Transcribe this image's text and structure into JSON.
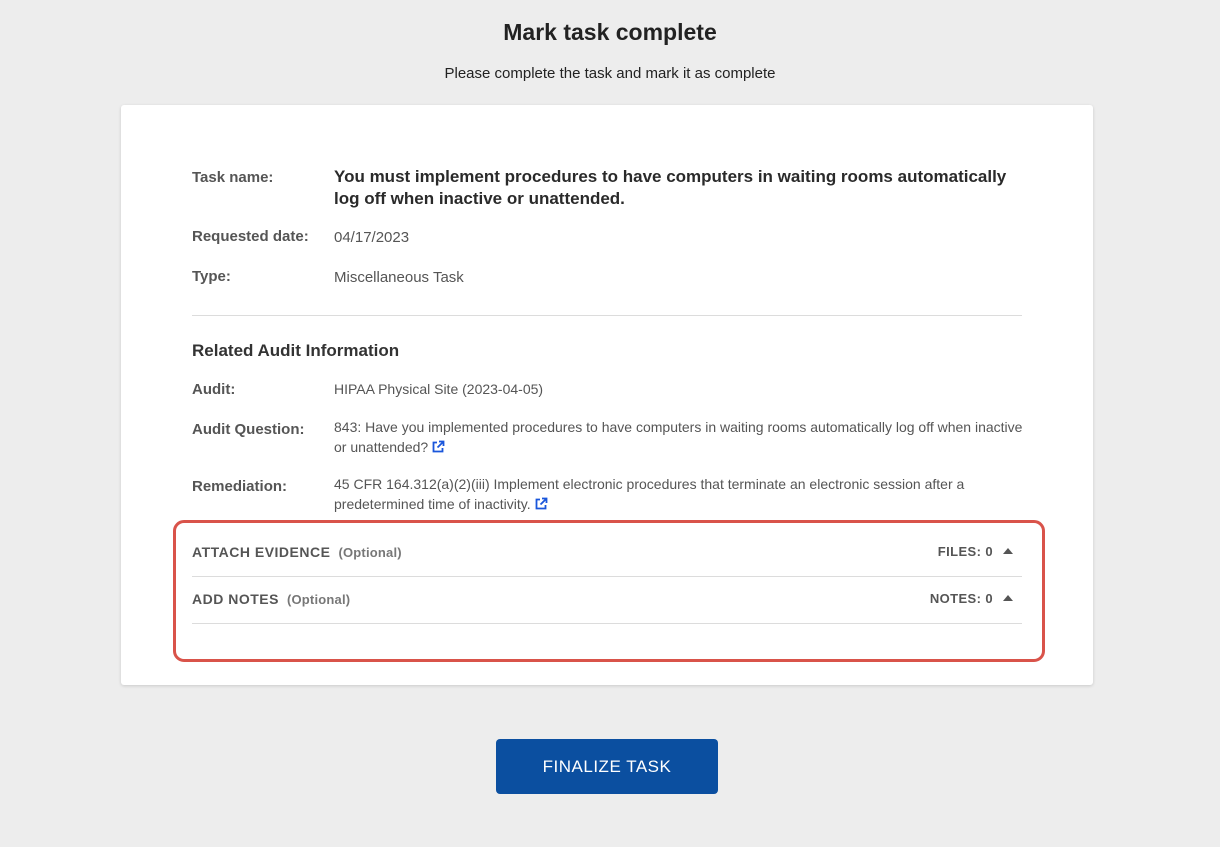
{
  "header": {
    "title": "Mark task complete",
    "subtitle": "Please complete the task and mark it as complete"
  },
  "task": {
    "name_label": "Task name:",
    "name_value": "You must implement procedures to have computers in waiting rooms automatically log off when inactive or unattended.",
    "date_label": "Requested date:",
    "date_value": "04/17/2023",
    "type_label": "Type:",
    "type_value": "Miscellaneous Task"
  },
  "audit": {
    "heading": "Related Audit Information",
    "audit_label": "Audit:",
    "audit_value": "HIPAA Physical Site (2023-04-05)",
    "question_label": "Audit Question:",
    "question_value": "843: Have you implemented procedures to have computers in waiting rooms automatically log off when inactive or unattended?",
    "remediation_label": "Remediation:",
    "remediation_value": "45 CFR 164.312(a)(2)(iii) Implement electronic procedures that terminate an electronic session after a predetermined time of inactivity."
  },
  "evidence": {
    "title": "ATTACH EVIDENCE",
    "optional": "(Optional)",
    "count": "FILES: 0"
  },
  "notes": {
    "title": "ADD NOTES",
    "optional": "(Optional)",
    "count": "NOTES: 0"
  },
  "actions": {
    "finalize_label": "FINALIZE TASK"
  },
  "icons": {
    "external_link": "external-link-icon",
    "caret": "caret-up-icon"
  },
  "colors": {
    "primary": "#0b4fa0",
    "link": "#1a56db",
    "highlight": "#d9534a",
    "background": "#ededed"
  }
}
